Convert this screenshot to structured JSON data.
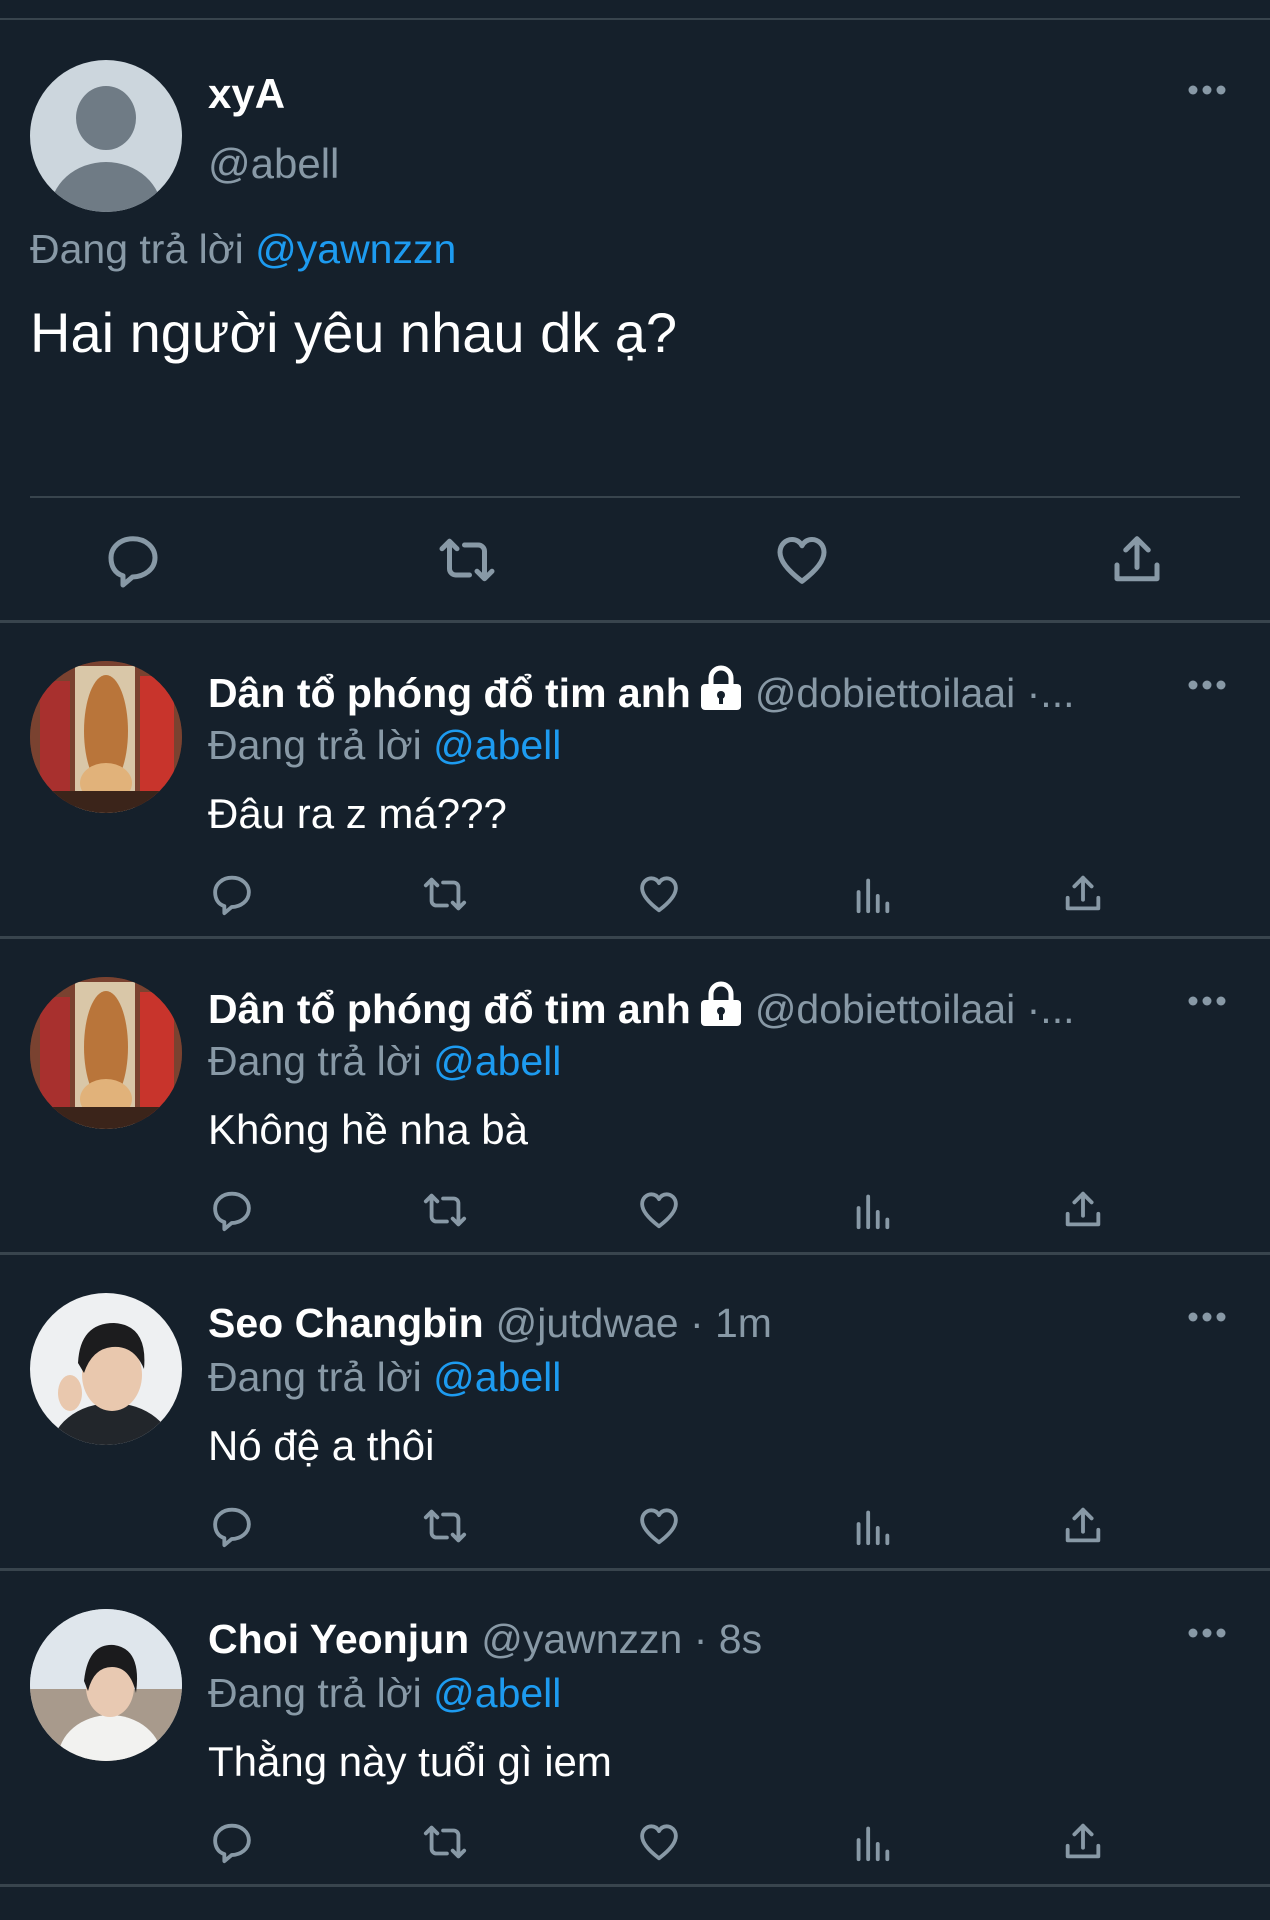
{
  "colors": {
    "background": "#15202b",
    "muted": "#8899a6",
    "accent": "#1d9bf0",
    "divider": "#38444d"
  },
  "main_tweet": {
    "display_name": "xyA",
    "handle": "@abell",
    "replying_prefix": "Đang trả lời ",
    "replying_to": "@yawnzzn",
    "text": "Hai người yêu nhau dk ạ?",
    "avatar_icon": "default-avatar-icon",
    "actions": [
      "reply-icon",
      "retweet-icon",
      "like-icon",
      "share-icon"
    ]
  },
  "replies": [
    {
      "display_name": "Dân tổ phóng đổ tim anh",
      "locked": true,
      "handle_meta": "@dobiettoilaai ·...",
      "replying_prefix": "Đang trả lời ",
      "replying_to": "@abell",
      "text": "Đâu ra z má???"
    },
    {
      "display_name": "Dân tổ phóng đổ tim anh",
      "locked": true,
      "handle_meta": "@dobiettoilaai ·...",
      "replying_prefix": "Đang trả lời ",
      "replying_to": "@abell",
      "text": "Không hề nha bà"
    },
    {
      "display_name": "Seo Changbin",
      "locked": false,
      "handle_meta": "@jutdwae · 1m",
      "replying_prefix": "Đang trả lời ",
      "replying_to": "@abell",
      "text": "Nó đệ a thôi"
    },
    {
      "display_name": "Choi Yeonjun",
      "locked": false,
      "handle_meta": "@yawnzzn · 8s",
      "replying_prefix": "Đang trả lời ",
      "replying_to": "@abell",
      "text": "Thằng này tuổi gì iem"
    }
  ],
  "reply_actions": [
    "reply-icon",
    "retweet-icon",
    "like-icon",
    "analytics-icon",
    "share-icon"
  ]
}
